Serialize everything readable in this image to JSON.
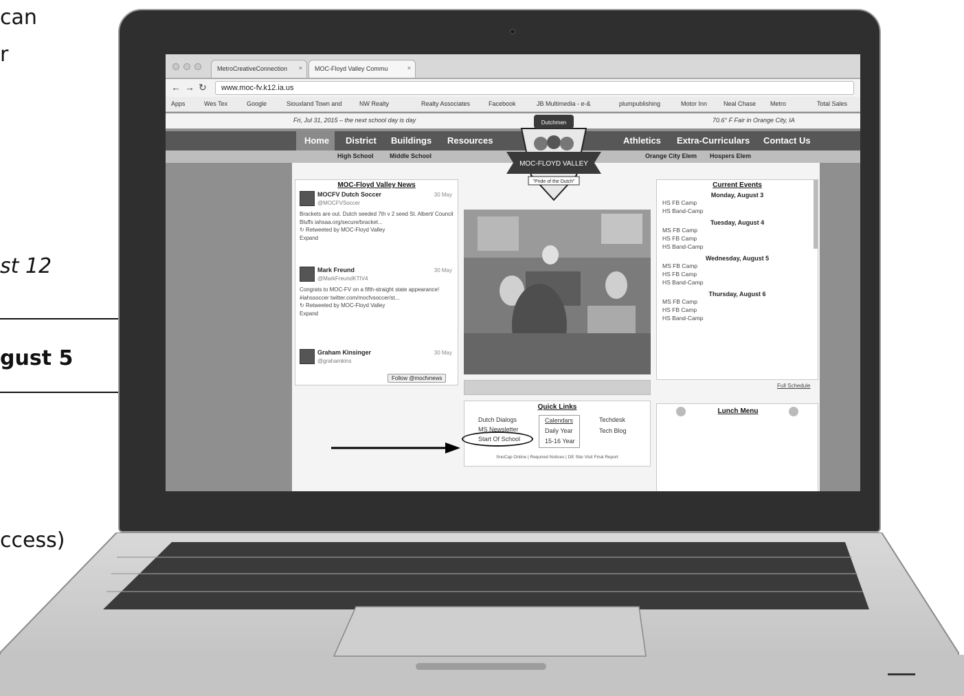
{
  "left_text": {
    "line1": "can",
    "line2": "r",
    "line3": "st 12",
    "line4": "gust 5",
    "line5": "ccess)"
  },
  "browser": {
    "tabs": [
      "MetroCreativeConnection",
      "MOC-Floyd Valley Commu"
    ],
    "url": "www.moc-fv.k12.ia.us",
    "bookmarks": [
      "Apps",
      "Wes Tex",
      "Google",
      "Siouxland Town and",
      "NW Realty",
      "Realty Associates",
      "Facebook",
      "JB Multimedia - e-&",
      "plumpublishing",
      "Motor Inn",
      "Neal Chase",
      "Metro",
      "Total Sales"
    ]
  },
  "site": {
    "date_notice": "Fri, Jul 31, 2015 – the next school day is day",
    "weather": "70.6° F Fair in Orange City, IA",
    "nav_left": [
      "Home",
      "District",
      "Buildings",
      "Resources"
    ],
    "nav_right": [
      "Athletics",
      "Extra-Curriculars",
      "Contact Us"
    ],
    "subnav_left": [
      "High School",
      "Middle School"
    ],
    "subnav_right": [
      "Orange City Elem",
      "Hospers Elem"
    ],
    "logo_top": "Dutchmen",
    "logo_banner": "MOC-FLOYD VALLEY",
    "logo_motto": "\"Pride of the Dutch\"",
    "news": {
      "title": "MOC-Floyd Valley News",
      "tweets": [
        {
          "name": "MOCFV Dutch Soccer",
          "handle": "@MOCFVSoccer",
          "date": "30 May",
          "text": "Brackets are out. Dutch seeded 7th v 2 seed St. Albert/ Council Bluffs iahsaa.org/secure/bracket...",
          "meta": "↻ Retweeted by MOC-Floyd Valley",
          "action": "Expand"
        },
        {
          "name": "Mark Freund",
          "handle": "@MarkFreundKTIV4",
          "date": "30 May",
          "text": "Congrats to MOC-FV on a fifth-straight state appearance! #iahssoccer twitter.com/mocfvsoccer/st...",
          "meta": "↻ Retweeted by MOC-Floyd Valley",
          "action": "Expand"
        },
        {
          "name": "Graham Kinsinger",
          "handle": "@grahamkins",
          "date": "30 May",
          "text": "",
          "meta": "",
          "action": ""
        }
      ],
      "follow": "Follow @mocfvnews"
    },
    "events": {
      "title": "Current Events",
      "days": [
        {
          "day": "Monday, August 3",
          "items": [
            "HS FB Camp",
            "HS Band-Camp"
          ]
        },
        {
          "day": "Tuesday, August 4",
          "items": [
            "MS FB Camp",
            "HS FB Camp",
            "HS Band-Camp"
          ]
        },
        {
          "day": "Wednesday, August 5",
          "items": [
            "MS FB Camp",
            "HS FB Camp",
            "HS Band-Camp"
          ]
        },
        {
          "day": "Thursday, August 6",
          "items": [
            "MS FB Camp",
            "HS FB Camp",
            "HS Band-Camp"
          ]
        }
      ],
      "full_schedule": "Full Schedule"
    },
    "quick_links": {
      "title": "Quick Links",
      "col1": [
        "Dutch Dialogs",
        "MS Newsletter",
        "Start Of School"
      ],
      "col2_title": "Calendars",
      "col2": [
        "Daily  Year",
        "15-16 Year"
      ],
      "col3": [
        "Techdesk",
        "Tech Blog"
      ],
      "footer": "SnoCap Online | Required Notices | DE Site Visit Final Report"
    },
    "lunch": {
      "title": "Lunch Menu"
    }
  },
  "colors": {
    "lid": "#2f2f2f",
    "navbar": "#575757",
    "site_bg": "#8f8f8f"
  }
}
